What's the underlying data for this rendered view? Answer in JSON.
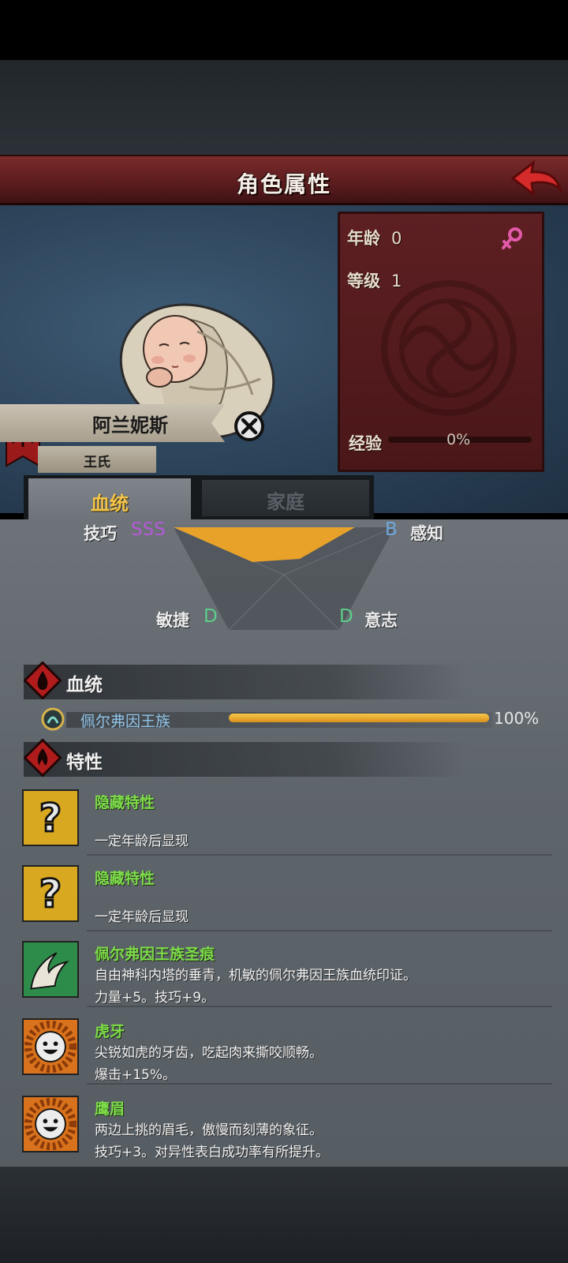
{
  "header": {
    "title": "角色属性"
  },
  "character": {
    "name": "阿兰妮斯",
    "family": "王氏",
    "age_label": "年龄",
    "age_value": "0",
    "level_label": "等级",
    "level_value": "1",
    "exp_label": "经验",
    "exp_pct": "0%",
    "exp_fraction": 0
  },
  "tabs": [
    {
      "label": "血统",
      "active": true
    },
    {
      "label": "家庭",
      "active": false
    }
  ],
  "attributes": {
    "skill": {
      "label": "技巧",
      "grade": "SSS"
    },
    "perception": {
      "label": "感知",
      "grade": "B"
    },
    "agility": {
      "label": "敏捷",
      "grade": "D"
    },
    "will": {
      "label": "意志",
      "grade": "D"
    }
  },
  "bloodline_section": {
    "title": "血统"
  },
  "bloodline": {
    "name": "佩尔弗因王族",
    "pct": "100%",
    "fraction": 1.0
  },
  "traits_section": {
    "title": "特性"
  },
  "traits": [
    {
      "name": "隐藏特性",
      "desc1": "",
      "desc2": "一定年龄后显现",
      "icon": "question-mark-icon"
    },
    {
      "name": "隐藏特性",
      "desc1": "",
      "desc2": "一定年龄后显现",
      "icon": "question-mark-icon"
    },
    {
      "name": "佩尔弗因王族圣痕",
      "desc1": "自由神科内塔的垂青，机敏的佩尔弗因王族血统印证。",
      "desc2": "力量+5。技巧+9。",
      "icon": "feather-wave-icon"
    },
    {
      "name": "虎牙",
      "desc1": "尖锐如虎的牙齿，吃起肉来撕咬顺畅。",
      "desc2": "爆击+15%。",
      "icon": "smiling-sun-icon"
    },
    {
      "name": "鹰眉",
      "desc1": "两边上挑的眉毛，傲慢而刻薄的象征。",
      "desc2": "技巧+3。对异性表白成功率有所提升。",
      "icon": "smiling-sun-icon"
    }
  ],
  "colors": {
    "grade_sss": "#b45ad6",
    "grade_b": "#6fa8dc",
    "grade_d": "#5ccf8a",
    "trait_name": "#7ddc4a",
    "bloodline_bar": "#e9a52a",
    "radar_fill": "#e8a22a"
  }
}
